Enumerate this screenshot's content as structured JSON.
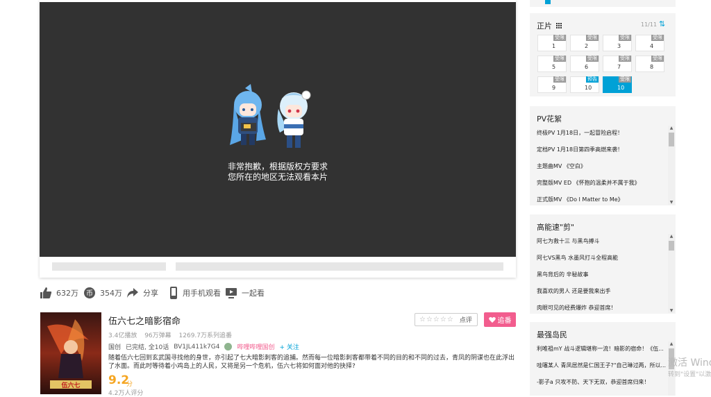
{
  "player": {
    "region_msg_line1": "非常抱歉，根据版权方要求",
    "region_msg_line2": "您所在的地区无法观看本片"
  },
  "actions": {
    "like": "632万",
    "coin": "354万",
    "share": "分享",
    "mobile": "用手机观看",
    "watch_together": "一起看"
  },
  "media": {
    "title": "伍六七之暗影宿命",
    "plays": "3.4亿播放",
    "danmaku": "96万弹幕",
    "followers": "1269.7万系列追番",
    "region": "国创",
    "status": "已完结, 全10话",
    "bvid": "BV1JL411k7G4",
    "uploader": "哔哩哔哩国创",
    "follow_uploader": "+ 关注",
    "desc": "随着伍六七回到玄武国寻找他的身世，亦引起了七大暗影刺客的追捕。然而每一位暗影刺客都带着不同的目的和不同的过去，青凤的阴谋也在此浮出了水面。而此时等待着小鸡岛上的人民，又将是另一个危机，伍六七将如何面对他的抉择?",
    "score": "9.2",
    "score_unit": "分",
    "rating_count": "4.2万人评分",
    "rate_label": "点评",
    "stars": "☆☆☆☆☆",
    "follow_button": "追番",
    "cover_text": "伍六七"
  },
  "episodes": {
    "title": "正片",
    "count": "11/11",
    "sort_icon": "⇅",
    "items": [
      {
        "num": "1",
        "tag": "受限"
      },
      {
        "num": "2",
        "tag": "受限"
      },
      {
        "num": "3",
        "tag": "受限"
      },
      {
        "num": "4",
        "tag": "受限"
      },
      {
        "num": "5",
        "tag": "受限"
      },
      {
        "num": "6",
        "tag": "受限"
      },
      {
        "num": "7",
        "tag": "受限"
      },
      {
        "num": "8",
        "tag": "受限"
      },
      {
        "num": "9",
        "tag": "受限"
      },
      {
        "num": "10",
        "tag": "预告"
      },
      {
        "num": "10",
        "tag": "受限"
      }
    ]
  },
  "pv": {
    "title": "PV花絮",
    "items": [
      "终极PV 1月18日，一起冒险启程！",
      "定档PV 1月18日第四季高燃来袭！",
      "主题曲MV 《空白》",
      "完整版MV ED 《怀抱的温柔并不属于我》",
      "正式版MV 《Do I Matter to Me》"
    ]
  },
  "highlights": {
    "title": "高能速\"剪\"",
    "items": [
      "阿七为救十三 与黑鸟搏斗",
      "阿七VS黑鸟 水墨风打斗全程高能",
      "黑鸟背后的 辛秘故事",
      "我喜欢的男人 还是要我来出手",
      "肉眼可见的经费爆炸 恭迎首席！"
    ]
  },
  "islanders": {
    "title": "最强岛民",
    "items": [
      "利唯祖mY 战斗逻辑堪称一流！暗影的宿命！《伍...",
      "哇噻某人 青凤居然是仁国王子?\"自己琳过两，所以...",
      "-影子a 只攻不防、天下无双，恭迎首席归来！"
    ]
  },
  "watermark": {
    "line1": "激活 Wind",
    "line2": "转到\"设置\"以激"
  },
  "colors": {
    "accent": "#00a1d6",
    "follow_pink": "#f25d8e",
    "score_orange": "#f5a623",
    "player_bg": "#323232"
  }
}
